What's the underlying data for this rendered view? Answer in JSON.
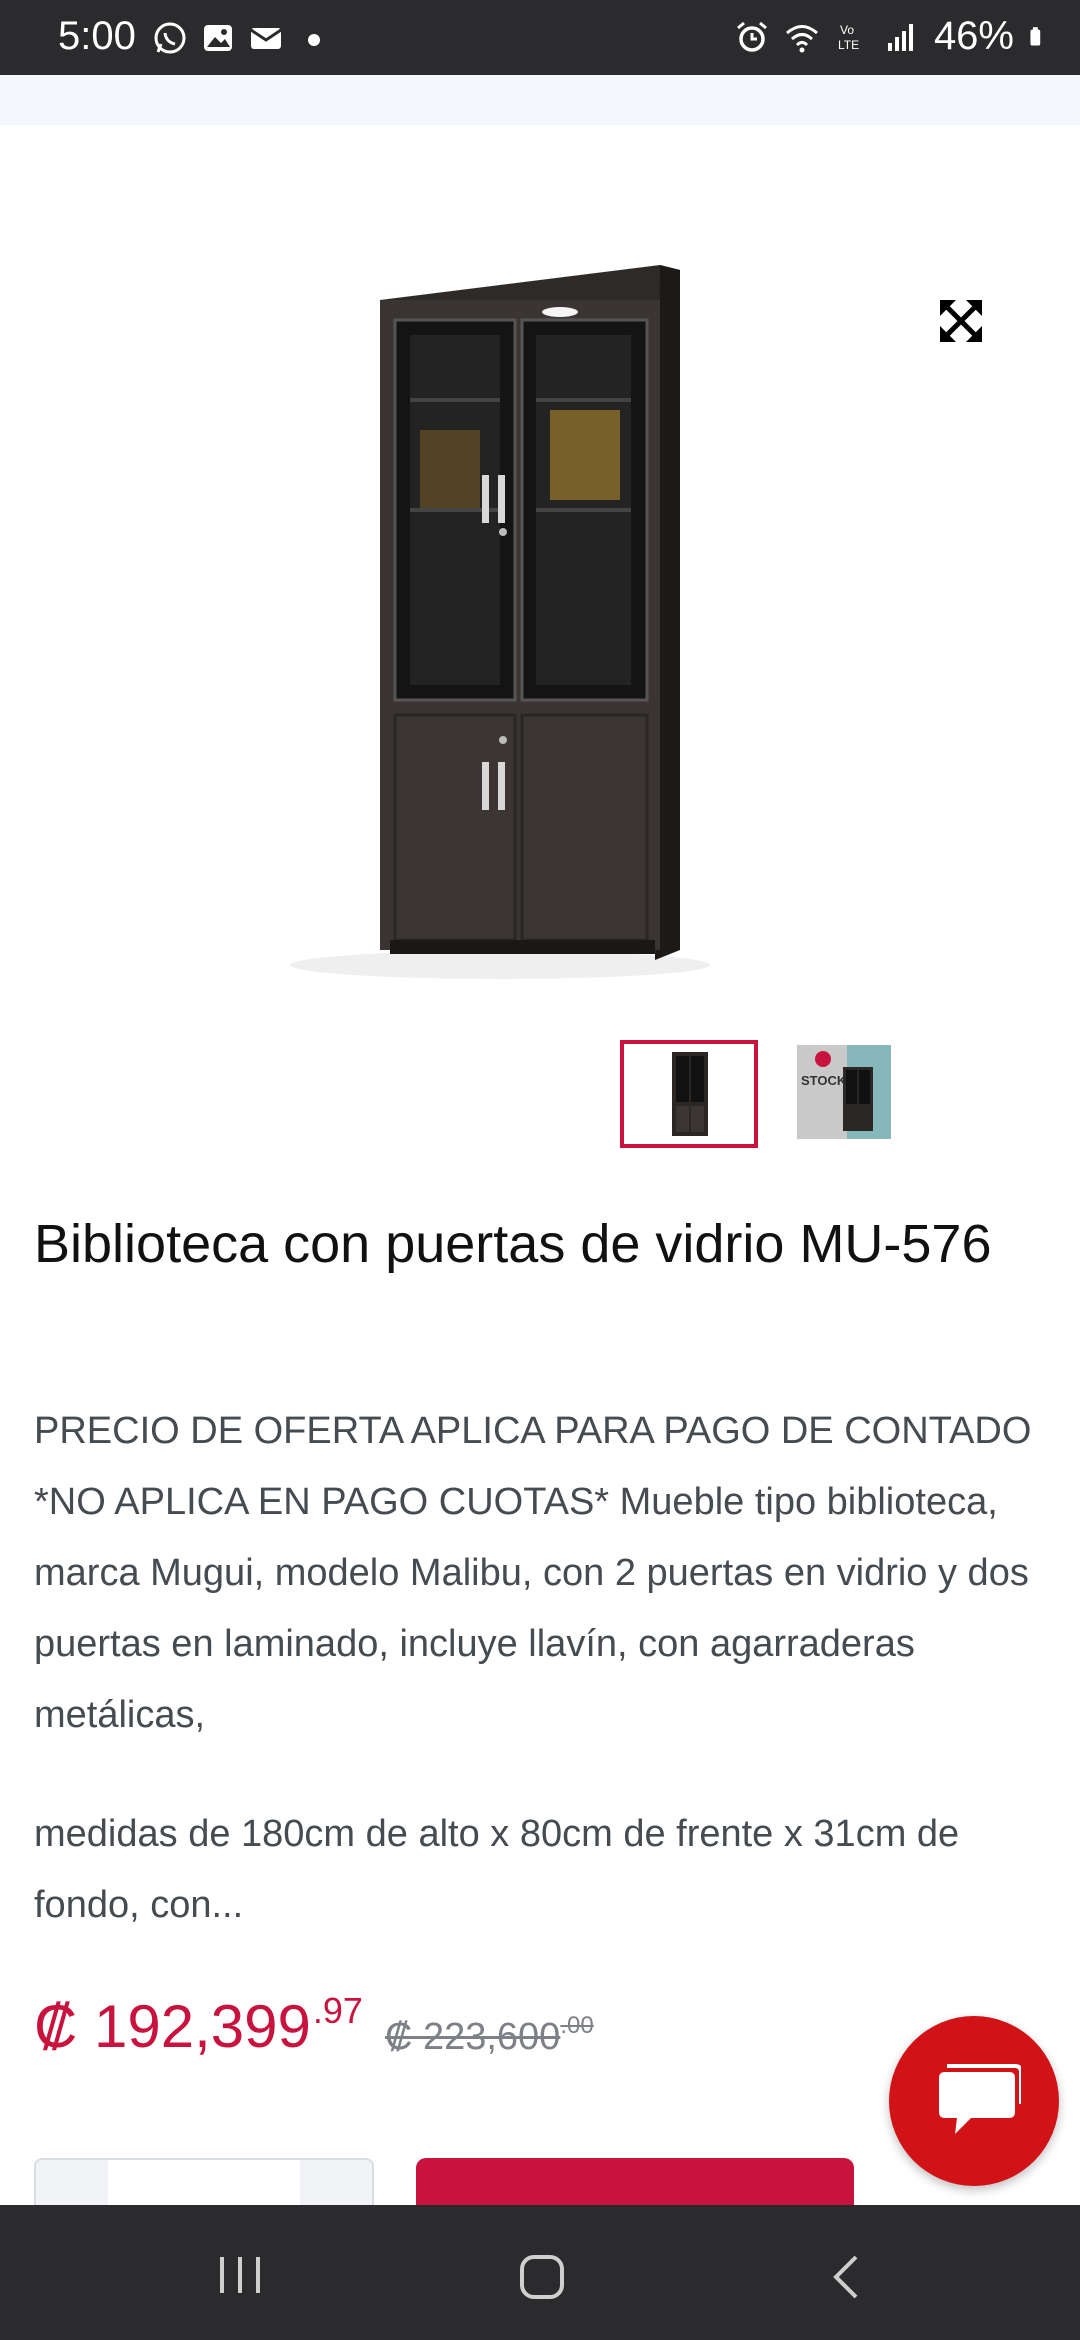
{
  "status_bar": {
    "time": "5:00",
    "battery": "46%",
    "left_icons": [
      "whatsapp-icon",
      "gallery-icon",
      "mail-icon",
      "dot-icon"
    ],
    "right_icons": [
      "alarm-icon",
      "wifi-icon",
      "volte-icon",
      "signal-icon",
      "battery-icon"
    ]
  },
  "product": {
    "title": "Biblioteca con puertas de vidrio MU-576",
    "description_1": "PRECIO DE OFERTA APLICA PARA PAGO DE CONTADO *NO APLICA EN PAGO CUOTAS* Mueble tipo biblioteca, marca Mugui, modelo Malibu, con 2 puertas en vidrio y dos puertas en laminado, incluye llavín, con agarraderas metálicas,",
    "description_2": "medidas de 180cm de alto x 80cm de frente x 31cm de fondo, con...",
    "price_current": "₡ 192,399",
    "price_current_cents": ".97",
    "price_old": "₡ 223,600",
    "price_old_cents": ".00",
    "thumb_2_label": "STOCK"
  },
  "colors": {
    "accent": "#c9133f",
    "chat": "#d11317",
    "system_bar": "#2b2b2e"
  }
}
